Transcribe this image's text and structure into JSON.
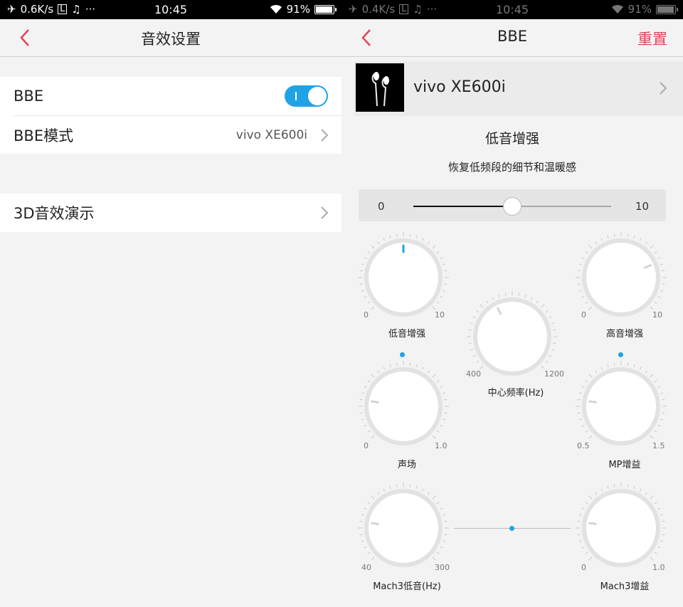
{
  "left": {
    "status": {
      "speed": "0.6K/s",
      "time": "10:45",
      "battery": "91%",
      "more": "···"
    },
    "title": "音效设置",
    "rows": [
      {
        "label": "BBE",
        "toggle_on": true
      },
      {
        "label": "BBE模式",
        "value": "vivo XE600i"
      },
      {
        "label": "3D音效演示"
      }
    ]
  },
  "right": {
    "status": {
      "speed": "0.4K/s",
      "time": "10:45",
      "battery": "91%",
      "more": "···"
    },
    "title": "BBE",
    "reset": "重置",
    "device": "vivo XE600i",
    "section_title": "低音增强",
    "section_desc": "恢复低频段的细节和温暖感",
    "slider": {
      "min": "0",
      "max": "10",
      "value": 5
    },
    "knobs": [
      {
        "id": "bass",
        "label": "低音增强",
        "min": "0",
        "max": "10",
        "fraction": 0.5
      },
      {
        "id": "treble",
        "label": "高音增强",
        "min": "0",
        "max": "10",
        "fraction": 0.75
      },
      {
        "id": "center",
        "label": "中心频率(Hz)",
        "min": "400",
        "max": "1200",
        "fraction": 0.4
      },
      {
        "id": "soundfield",
        "label": "声场",
        "min": "0",
        "max": "1.0",
        "fraction": 0.2
      },
      {
        "id": "mp",
        "label": "MP增益",
        "min": "0.5",
        "max": "1.5",
        "fraction": 0.2
      },
      {
        "id": "mach3bass",
        "label": "Mach3低音(Hz)",
        "min": "40",
        "max": "300",
        "fraction": 0.2
      },
      {
        "id": "mach3gain",
        "label": "Mach3增益",
        "min": "0",
        "max": "1.0",
        "fraction": 0.2
      }
    ],
    "accent": "#1fa3e6",
    "reset_color": "#e0455a"
  }
}
